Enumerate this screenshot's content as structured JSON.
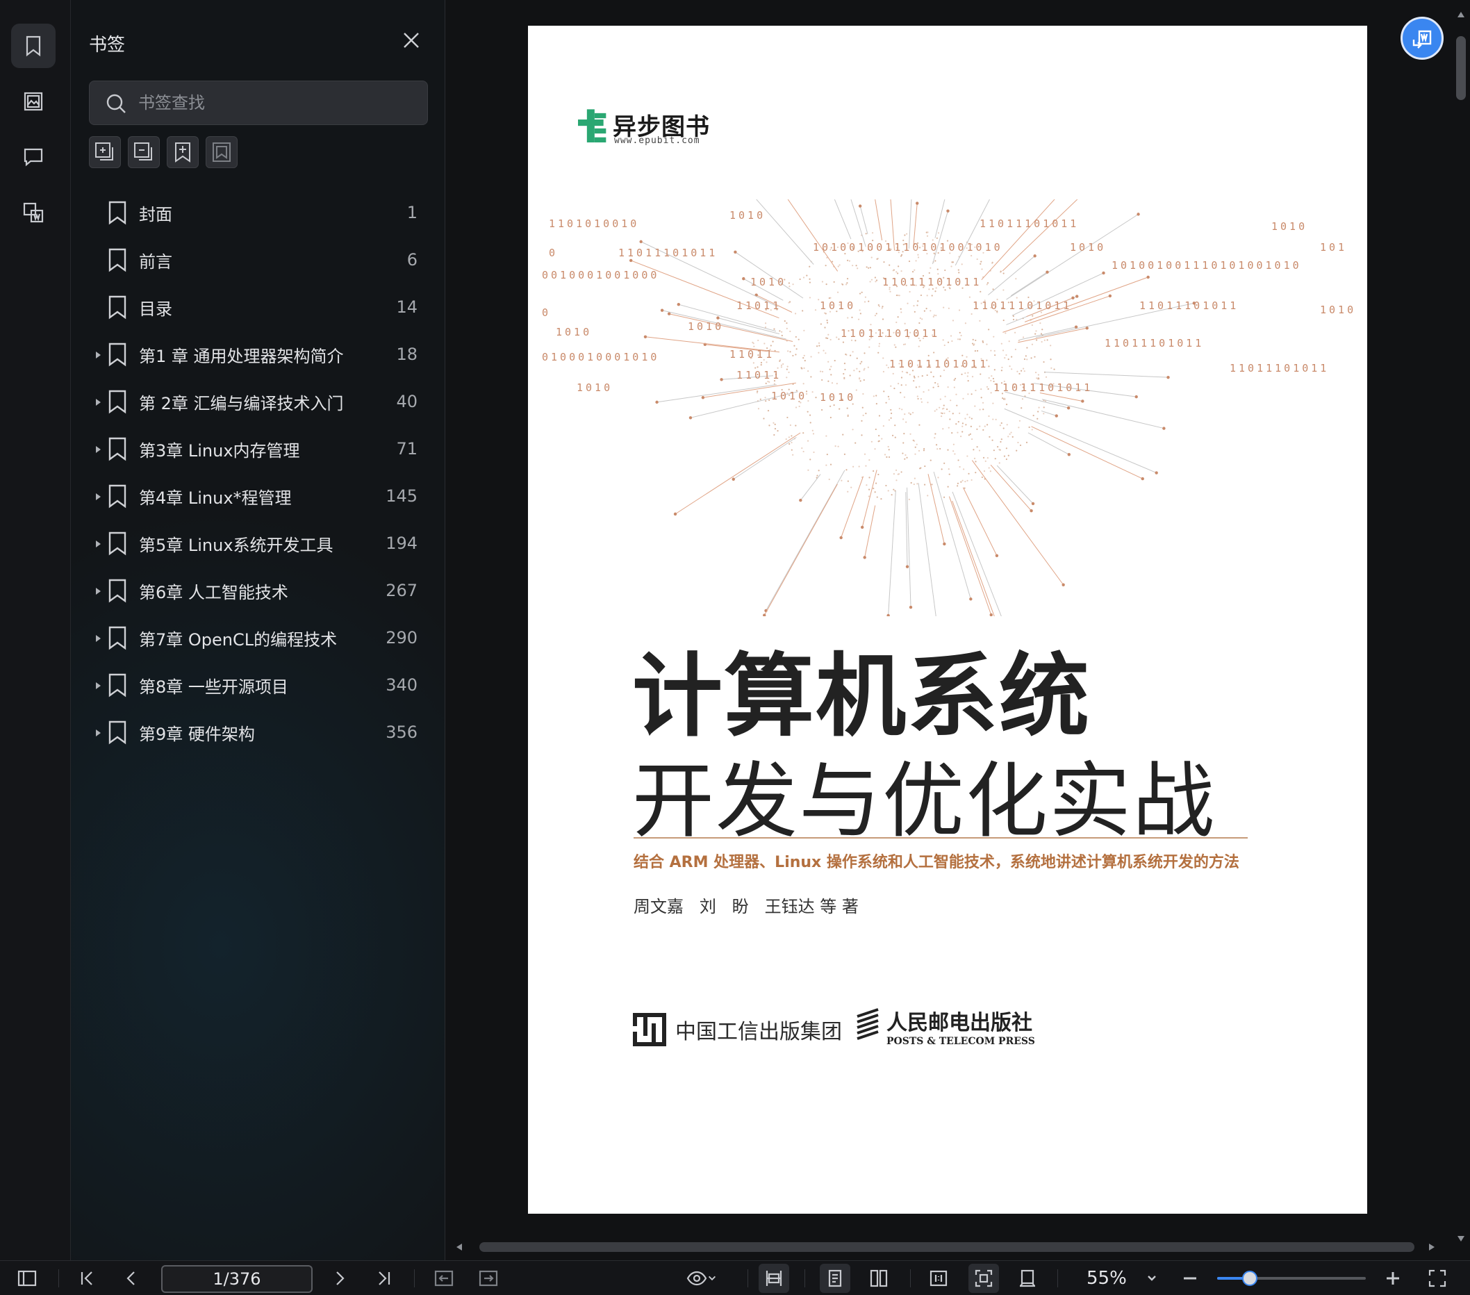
{
  "sidebar_panel": {
    "title": "书签",
    "search_placeholder": "书签查找",
    "items": [
      {
        "label": "封面",
        "page": "1"
      },
      {
        "label": "前言",
        "page": "6"
      },
      {
        "label": "目录",
        "page": "14"
      },
      {
        "label": "第1 章 通用处理器架构简介",
        "page": "18"
      },
      {
        "label": "第 2章 汇编与编译技术入门",
        "page": "40"
      },
      {
        "label": "第3章 Linux内存管理",
        "page": "71"
      },
      {
        "label": "第4章 Linux*程管理",
        "page": "145"
      },
      {
        "label": "第5章 Linux系统开发工具",
        "page": "194"
      },
      {
        "label": "第6章 人工智能技术",
        "page": "267"
      },
      {
        "label": "第7章 OpenCL的编程技术",
        "page": "290"
      },
      {
        "label": "第8章 一些开源项目",
        "page": "340"
      },
      {
        "label": "第9章 硬件架构",
        "page": "356"
      }
    ]
  },
  "cover": {
    "publisher_logo_name": "异步图书",
    "publisher_logo_url": "www.epubit.com",
    "binary_text": [
      "1101010010",
      "1010",
      "11011101011",
      "1010",
      "0",
      "11011101011",
      "101001001110101001010",
      "1010",
      "101",
      "0010001001000",
      "1010",
      "11011101011",
      "101001001110101001010",
      "11011",
      "1010",
      "11011101011",
      "11011101011",
      "1010",
      "0",
      "1010",
      "1010",
      "11011101011",
      "11011101011",
      "0100010001010",
      "11011",
      "11011101011",
      "11011101011",
      "11011",
      "1010",
      "11011101011",
      "1010",
      "1010"
    ],
    "title_line1": "计算机系统",
    "title_line2": "开发与优化实战",
    "subtitle": "结合 ARM 处理器、Linux 操作系统和人工智能技术，系统地讲述计算机系统开发的方法",
    "authors": "周文嘉   刘   盼   王钰达 等 著",
    "publisher1": "中国工信出版集团",
    "publisher2_cn": "人民邮电出版社",
    "publisher2_en": "POSTS & TELECOM PRESS"
  },
  "toolbar": {
    "page_value": "1/376",
    "zoom_label": "55%",
    "zoom_level_fraction": 0.22
  },
  "colors": {
    "accent": "#3a86f0",
    "cover_accent": "#b4703f"
  }
}
